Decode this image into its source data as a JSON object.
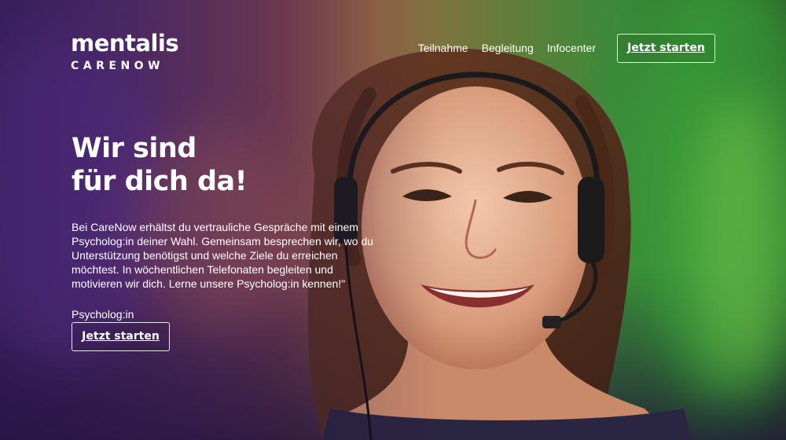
{
  "brand": {
    "name": "mentalis",
    "sub": "CARENOW"
  },
  "nav": {
    "items": [
      {
        "label": "Teilnahme"
      },
      {
        "label": "Begleitung"
      },
      {
        "label": "Infocenter"
      }
    ],
    "cta_label": "Jetzt starten"
  },
  "hero": {
    "headline_line1": "Wir sind",
    "headline_line2": "für dich da!",
    "body_line1": "Bei CareNow erhältst du vertrauliche Gespräche mit einem",
    "body_line2": "Psycholog:in deiner Wahl. Gemeinsam besprechen wir, wo du",
    "body_line3": "Unterstützung benötigst und welche Ziele du erreichen",
    "body_line4": "möchtest. In wöchentlichen Telefonaten begleiten und",
    "body_line5": "motivieren wir dich. Lerne unsere Psycholog:in kennen!\"",
    "small_label": "Psycholog:in",
    "cta_label": "Jetzt starten",
    "image_name": "smiling-woman-headset-photo"
  },
  "colors": {
    "accent_purple": "#6b3a9a",
    "accent_green": "#3c8a3a",
    "text": "#ffffff"
  }
}
